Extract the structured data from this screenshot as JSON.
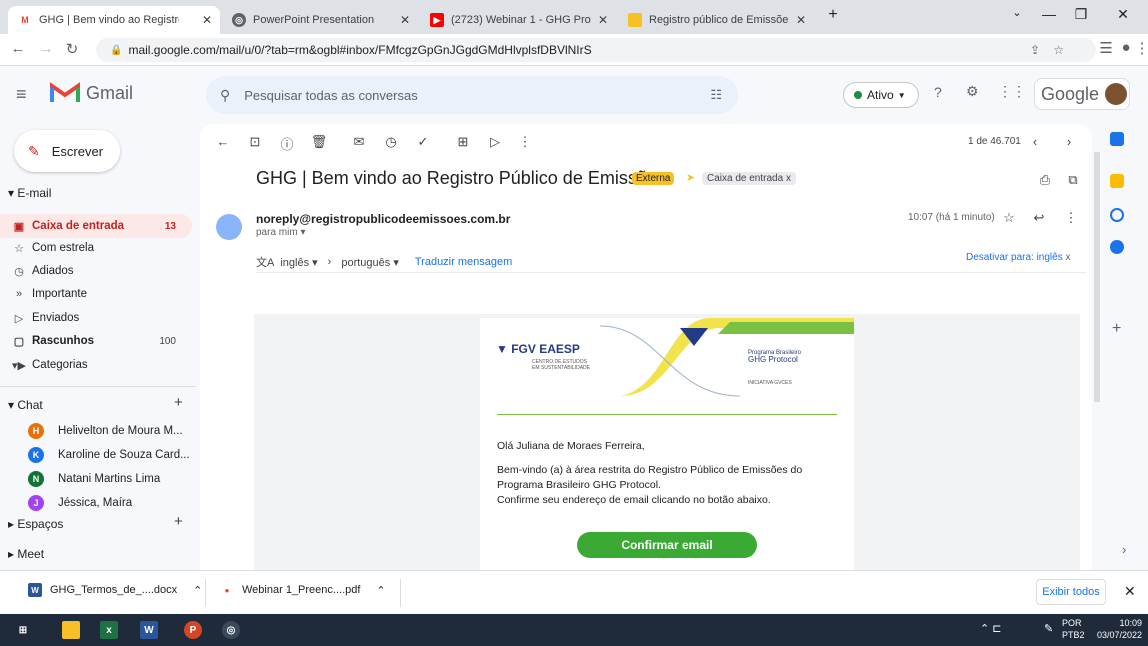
{
  "browser": {
    "tabs": [
      {
        "title": "GHG | Bem vindo ao Registro Púb",
        "active": true
      },
      {
        "title": "PowerPoint Presentation",
        "active": false
      },
      {
        "title": "(2723) Webinar 1 - GHG Protoco",
        "active": false
      },
      {
        "title": "Registro público de Emissões",
        "active": false
      }
    ],
    "url": "mail.google.com/mail/u/0/?tab=rm&ogbl#inbox/FMfcgzGpGnJGgdGMdHlvplsfDBVlNIrS"
  },
  "gmail": {
    "logo_text": "Gmail",
    "search_placeholder": "Pesquisar todas as conversas",
    "status": "Ativo",
    "google_text": "Google",
    "compose_label": "Escrever",
    "email_section": "E-mail",
    "nav": [
      {
        "label": "Caixa de entrada",
        "count": "13",
        "icon": "inbox-icon"
      },
      {
        "label": "Com estrela",
        "count": "",
        "icon": "star-icon"
      },
      {
        "label": "Adiados",
        "count": "",
        "icon": "clock-icon"
      },
      {
        "label": "Importante",
        "count": "",
        "icon": "important-icon"
      },
      {
        "label": "Enviados",
        "count": "",
        "icon": "send-icon"
      },
      {
        "label": "Rascunhos",
        "count": "100",
        "icon": "draft-icon"
      },
      {
        "label": "Categorias",
        "count": "",
        "icon": "label-icon"
      }
    ],
    "chat_section": "Chat",
    "chats": [
      {
        "name": "Helivelton de Moura M...",
        "initial": "H",
        "color": "#e8710a"
      },
      {
        "name": "Karoline de Souza Card...",
        "initial": "K",
        "color": "#1a73e8"
      },
      {
        "name": "Natani Martins Lima",
        "initial": "N",
        "color": "#137333"
      },
      {
        "name": "Jéssica, Maíra",
        "initial": "J",
        "color": "#a142f4"
      }
    ],
    "spaces_section": "Espaços",
    "meet_section": "Meet",
    "pagination": "1 de 46.701",
    "subject": "GHG | Bem vindo ao Registro Público de Emissões",
    "badge_external": "Externa",
    "badge_inbox": "Caixa de entrada",
    "sender": "noreply@registropublicodeemissoes.com.br",
    "to": "para mim",
    "time": "10:07 (há 1 minuto)",
    "translate_from": "inglês",
    "translate_to": "português",
    "translate_link": "Traduzir mensagem",
    "translate_disable": "Desativar para: inglês",
    "body": {
      "logo_left": "FGV EAESP",
      "logo_left_sub": "CENTRO DE ESTUDOS EM SUSTENTABILIDADE",
      "logo_right": "Programa Brasileiro GHG Protocol",
      "logo_right_sub": "INICIATIVA GVCES",
      "greeting": "Olá Juliana de Moraes Ferreira,",
      "line1": "Bem-vindo (a) à área restrita do Registro Público de Emissões do",
      "line2": "Programa Brasileiro GHG Protocol.",
      "line3": "Confirme seu endereço de email clicando no botão abaixo.",
      "button": "Confirmar email"
    }
  },
  "downloads": {
    "items": [
      {
        "name": "GHG_Termos_de_....docx",
        "type": "docx"
      },
      {
        "name": "Webinar 1_Preenc....pdf",
        "type": "pdf"
      }
    ],
    "show_all": "Exibir todos"
  },
  "taskbar": {
    "lang": "POR",
    "layout": "PTB2",
    "time": "10:09",
    "date": "03/07/2022"
  },
  "colors": {
    "accent_red": "#c5221f",
    "button_green": "#3aaa35",
    "link_blue": "#1a73e8"
  }
}
